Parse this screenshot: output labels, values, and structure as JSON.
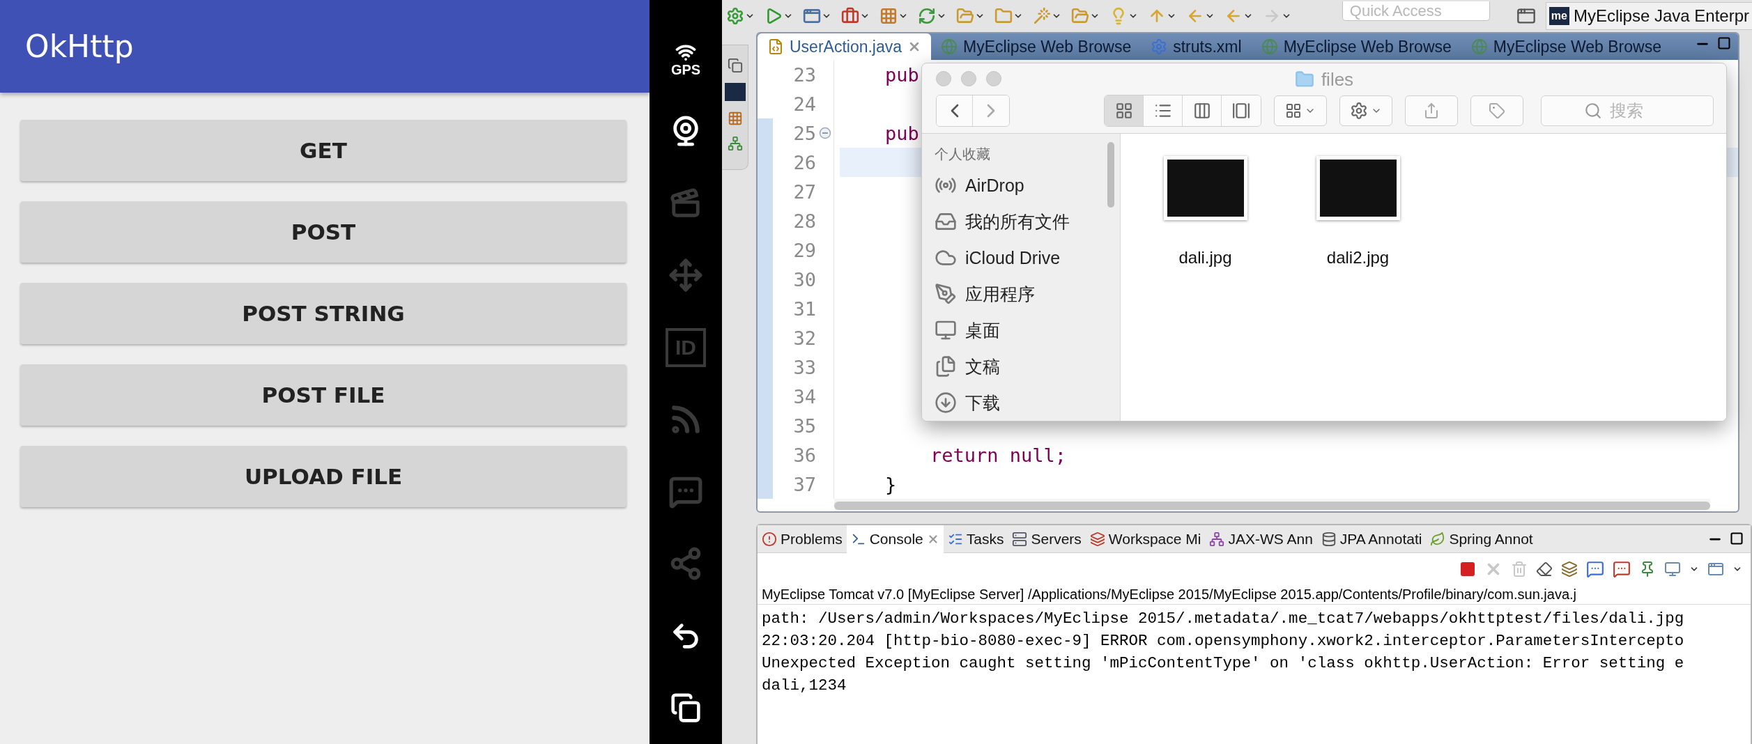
{
  "android": {
    "title": "OkHttp",
    "buttons": [
      "GET",
      "POST",
      "POST STRING",
      "POST FILE",
      "UPLOAD FILE"
    ]
  },
  "emulator_controls": {
    "gps_label": "GPS",
    "id_label": "ID"
  },
  "ide": {
    "quick_access": {
      "placeholder": "Quick Access"
    },
    "perspective_logo": "me",
    "perspective": "MyEclipse Java Enterpr",
    "editor_tabs": [
      {
        "label": "UserAction.java",
        "kind": "java",
        "selected": true
      },
      {
        "label": "MyEclipse Web Browse",
        "kind": "browser",
        "selected": false
      },
      {
        "label": "struts.xml",
        "kind": "xml",
        "selected": false
      },
      {
        "label": "MyEclipse Web Browse",
        "kind": "browser",
        "selected": false
      },
      {
        "label": "MyEclipse Web Browse",
        "kind": "browser",
        "selected": false
      }
    ],
    "editor_lines": [
      {
        "number": "23",
        "text": "    pub",
        "kind": "keyword",
        "current": false,
        "foldable": false,
        "marked": false
      },
      {
        "number": "24",
        "current": false,
        "foldable": false,
        "marked": false
      },
      {
        "number": "25",
        "text": "    pub",
        "kind": "keyword",
        "current": false,
        "foldable": true,
        "marked": true
      },
      {
        "number": "26",
        "current": true,
        "foldable": false,
        "marked": true
      },
      {
        "number": "27",
        "current": false,
        "foldable": false,
        "marked": true
      },
      {
        "number": "28",
        "current": false,
        "foldable": false,
        "marked": true
      },
      {
        "number": "29",
        "current": false,
        "foldable": false,
        "marked": true
      },
      {
        "number": "30",
        "current": false,
        "foldable": false,
        "marked": true
      },
      {
        "number": "31",
        "current": false,
        "foldable": false,
        "marked": true
      },
      {
        "number": "32",
        "current": false,
        "foldable": false,
        "marked": true
      },
      {
        "number": "33",
        "current": false,
        "foldable": false,
        "marked": true
      },
      {
        "number": "34",
        "current": false,
        "foldable": false,
        "marked": true
      },
      {
        "number": "35",
        "current": false,
        "foldable": false,
        "marked": true
      },
      {
        "number": "36",
        "text": "        return null;",
        "kind": "keyword",
        "current": false,
        "foldable": false,
        "marked": true
      },
      {
        "number": "37",
        "text": "    }",
        "kind": "plain",
        "current": false,
        "foldable": false,
        "marked": true
      }
    ],
    "console": {
      "tabs": [
        {
          "label": "Problems",
          "kind": "problems",
          "selected": false
        },
        {
          "label": "Console",
          "kind": "console",
          "selected": true
        },
        {
          "label": "Tasks",
          "kind": "tasks",
          "selected": false
        },
        {
          "label": "Servers",
          "kind": "servers",
          "selected": false
        },
        {
          "label": "Workspace Mi",
          "kind": "workspace",
          "selected": false
        },
        {
          "label": "JAX-WS Ann",
          "kind": "jaxws",
          "selected": false
        },
        {
          "label": "JPA Annotati",
          "kind": "jpa",
          "selected": false
        },
        {
          "label": "Spring Annot",
          "kind": "spring",
          "selected": false
        }
      ],
      "description": "MyEclipse Tomcat v7.0 [MyEclipse Server] /Applications/MyEclipse 2015/MyEclipse 2015.app/Contents/Profile/binary/com.sun.java.j",
      "lines": [
        "path: /Users/admin/Workspaces/MyEclipse 2015/.metadata/.me_tcat7/webapps/okhttptest/files/dali.jpg",
        "22:03:20.204 [http-bio-8080-exec-9] ERROR com.opensymphony.xwork2.interceptor.ParametersIntercepto",
        "Unexpected Exception caught setting 'mPicContentType' on 'class okhttp.UserAction: Error setting e",
        "dali,1234"
      ]
    }
  },
  "finder": {
    "title": "files",
    "view_buttons": [
      {
        "kind": "icons",
        "selected": true
      },
      {
        "kind": "list",
        "selected": false
      },
      {
        "kind": "columns",
        "selected": false
      },
      {
        "kind": "gallery",
        "selected": false
      }
    ],
    "search": {
      "placeholder": "搜索"
    },
    "sidebar_heading": "个人收藏",
    "sidebar_items": [
      {
        "label": "AirDrop",
        "kind": "airdrop"
      },
      {
        "label": "我的所有文件",
        "kind": "allfiles"
      },
      {
        "label": "iCloud Drive",
        "kind": "cloud"
      },
      {
        "label": "应用程序",
        "kind": "apps"
      },
      {
        "label": "桌面",
        "kind": "desktop"
      },
      {
        "label": "文稿",
        "kind": "documents"
      },
      {
        "label": "下载",
        "kind": "downloads"
      }
    ],
    "files": [
      {
        "name": "dali.jpg"
      },
      {
        "name": "dali2.jpg"
      }
    ]
  }
}
